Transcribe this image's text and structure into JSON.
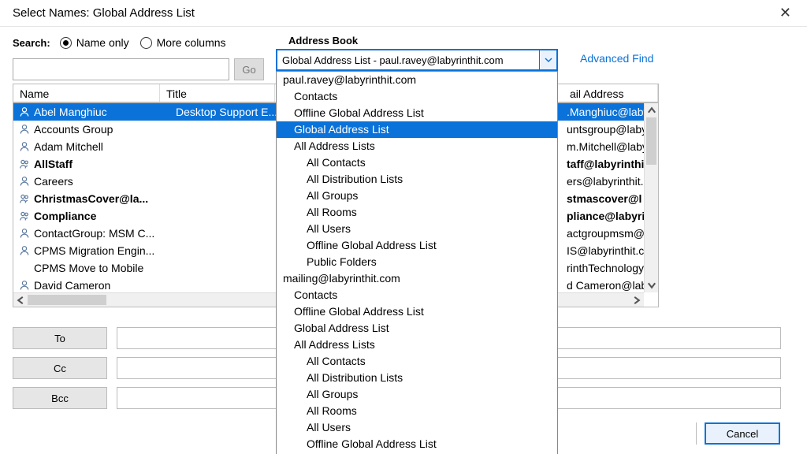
{
  "window": {
    "title": "Select Names: Global Address List"
  },
  "search": {
    "label": "Search:",
    "radio_name_only": "Name only",
    "radio_more_cols": "More columns",
    "go": "Go"
  },
  "address_book": {
    "label": "Address Book",
    "selected": "Global Address List - paul.ravey@labyrinthit.com",
    "advanced_find": "Advanced Find"
  },
  "columns": {
    "name": "Name",
    "title": "Title",
    "email": "ail Address"
  },
  "rows": [
    {
      "bold": false,
      "sel": true,
      "icon": "person",
      "name": "Abel Manghiuc",
      "title": "Desktop Support E...",
      "email": ".Manghiuc@laby"
    },
    {
      "bold": false,
      "sel": false,
      "icon": "person",
      "name": "Accounts Group",
      "title": "",
      "email": "untsgroup@laby"
    },
    {
      "bold": false,
      "sel": false,
      "icon": "person",
      "name": "Adam Mitchell",
      "title": "",
      "email": "m.Mitchell@laby"
    },
    {
      "bold": true,
      "sel": false,
      "icon": "group",
      "name": "AllStaff",
      "title": "",
      "email": "taff@labyrinthit"
    },
    {
      "bold": false,
      "sel": false,
      "icon": "person",
      "name": "Careers",
      "title": "",
      "email": "ers@labyrinthit."
    },
    {
      "bold": true,
      "sel": false,
      "icon": "group",
      "name": "ChristmasCover@la...",
      "title": "",
      "email": "stmascover@l"
    },
    {
      "bold": true,
      "sel": false,
      "icon": "group",
      "name": "Compliance",
      "title": "",
      "email": "pliance@labyri"
    },
    {
      "bold": false,
      "sel": false,
      "icon": "person",
      "name": "ContactGroup: MSM C...",
      "title": "",
      "email": "actgroupmsm@"
    },
    {
      "bold": false,
      "sel": false,
      "icon": "person",
      "name": "CPMS Migration Engin...",
      "title": "",
      "email": "IS@labyrinthit.co"
    },
    {
      "bold": false,
      "sel": false,
      "icon": "",
      "name": "CPMS Move to Mobile",
      "title": "",
      "email": "rinthTechnology"
    },
    {
      "bold": false,
      "sel": false,
      "icon": "person",
      "name": "David Cameron",
      "title": "",
      "email": "d Cameron@laby"
    }
  ],
  "dropdown": [
    {
      "indent": 0,
      "text": "paul.ravey@labyrinthit.com",
      "sel": false
    },
    {
      "indent": 1,
      "text": "Contacts",
      "sel": false
    },
    {
      "indent": 1,
      "text": "Offline Global Address List",
      "sel": false
    },
    {
      "indent": 1,
      "text": "Global Address List",
      "sel": true
    },
    {
      "indent": 1,
      "text": "All Address Lists",
      "sel": false
    },
    {
      "indent": 2,
      "text": "All Contacts",
      "sel": false
    },
    {
      "indent": 2,
      "text": "All Distribution Lists",
      "sel": false
    },
    {
      "indent": 2,
      "text": "All Groups",
      "sel": false
    },
    {
      "indent": 2,
      "text": "All Rooms",
      "sel": false
    },
    {
      "indent": 2,
      "text": "All Users",
      "sel": false
    },
    {
      "indent": 2,
      "text": "Offline Global Address List",
      "sel": false
    },
    {
      "indent": 2,
      "text": "Public Folders",
      "sel": false
    },
    {
      "indent": 0,
      "text": "mailing@labyrinthit.com",
      "sel": false
    },
    {
      "indent": 1,
      "text": "Contacts",
      "sel": false
    },
    {
      "indent": 1,
      "text": "Offline Global Address List",
      "sel": false
    },
    {
      "indent": 1,
      "text": "Global Address List",
      "sel": false
    },
    {
      "indent": 1,
      "text": "All Address Lists",
      "sel": false
    },
    {
      "indent": 2,
      "text": "All Contacts",
      "sel": false
    },
    {
      "indent": 2,
      "text": "All Distribution Lists",
      "sel": false
    },
    {
      "indent": 2,
      "text": "All Groups",
      "sel": false
    },
    {
      "indent": 2,
      "text": "All Rooms",
      "sel": false
    },
    {
      "indent": 2,
      "text": "All Users",
      "sel": false
    },
    {
      "indent": 2,
      "text": "Offline Global Address List",
      "sel": false
    }
  ],
  "recipients": {
    "to": "To",
    "cc": "Cc",
    "bcc": "Bcc"
  },
  "buttons": {
    "cancel": "Cancel"
  }
}
